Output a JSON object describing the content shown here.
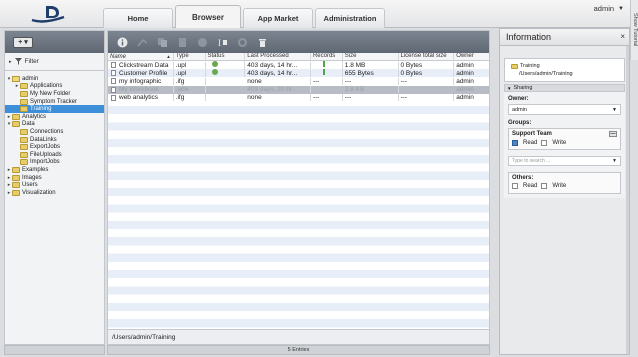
{
  "topbar": {
    "tabs": [
      "Home",
      "Browser",
      "App Market",
      "Administration"
    ],
    "user": "admin",
    "side_tab": "Show Tutorial"
  },
  "left": {
    "add_label": "+ ▾",
    "filter": "Filter",
    "tree": [
      {
        "label": "admin",
        "indent": 0,
        "arrow": "▾",
        "type": "home"
      },
      {
        "label": "Applications",
        "indent": 1,
        "arrow": "▸",
        "type": "folder"
      },
      {
        "label": "My New Folder",
        "indent": 1,
        "arrow": "",
        "type": "folder"
      },
      {
        "label": "Symptom Tracker",
        "indent": 1,
        "arrow": "",
        "type": "folder"
      },
      {
        "label": "Training",
        "indent": 1,
        "arrow": "",
        "type": "folder",
        "selected": true
      },
      {
        "label": "Analytics",
        "indent": 0,
        "arrow": "▸",
        "type": "folder"
      },
      {
        "label": "Data",
        "indent": 0,
        "arrow": "▾",
        "type": "folder"
      },
      {
        "label": "Connections",
        "indent": 1,
        "arrow": "",
        "type": "folder"
      },
      {
        "label": "DataLinks",
        "indent": 1,
        "arrow": "",
        "type": "folder"
      },
      {
        "label": "ExportJobs",
        "indent": 1,
        "arrow": "",
        "type": "folder"
      },
      {
        "label": "FileUploads",
        "indent": 1,
        "arrow": "",
        "type": "folder"
      },
      {
        "label": "ImportJobs",
        "indent": 1,
        "arrow": "",
        "type": "folder"
      },
      {
        "label": "Examples",
        "indent": 0,
        "arrow": "▸",
        "type": "folder"
      },
      {
        "label": "Images",
        "indent": 0,
        "arrow": "▸",
        "type": "folder"
      },
      {
        "label": "Users",
        "indent": 0,
        "arrow": "▸",
        "type": "folder"
      },
      {
        "label": "Visualization",
        "indent": 0,
        "arrow": "▸",
        "type": "folder"
      }
    ]
  },
  "grid": {
    "headers": [
      "Name",
      "Type",
      "Status",
      "Last Processed",
      "Records",
      "Size",
      "License total size",
      "Owner"
    ],
    "sort_indicator": "▲",
    "rows": [
      {
        "name": "Clickstream Data",
        "type": ".upl",
        "status": "ok",
        "last": "403 days, 14 hr...",
        "records": "bar",
        "size": "1.8 MB",
        "license": "0 Bytes",
        "owner": "admin"
      },
      {
        "name": "Customer Profile",
        "type": ".upl",
        "status": "ok",
        "last": "403 days, 14 hr...",
        "records": "bar",
        "size": "655 Bytes",
        "license": "0 Bytes",
        "owner": "admin"
      },
      {
        "name": "my infographic",
        "type": ".ifg",
        "status": "",
        "last": "none",
        "records": "---",
        "size": "---",
        "license": "---",
        "owner": "admin"
      },
      {
        "name": "My Workbook",
        "type": ".wbk",
        "status": "",
        "last": "403 days, 20 hr...",
        "records": "",
        "size": "2.8 KB",
        "license": "",
        "owner": "admin",
        "selected": true
      },
      {
        "name": "web analytics",
        "type": ".ifg",
        "status": "",
        "last": "none",
        "records": "---",
        "size": "---",
        "license": "---",
        "owner": "admin"
      }
    ],
    "path": "/Users/admin/Training",
    "entries": "5 Entries"
  },
  "info": {
    "title": "Information",
    "close": "×",
    "folder_name": "Training",
    "folder_path": "/Users/admin/Training",
    "sharing": "Sharing",
    "owner_label": "Owner:",
    "owner_value": "admin",
    "groups_label": "Groups:",
    "group_name": "Support Team",
    "group_btn": "—",
    "read": "Read",
    "write": "Write",
    "search_placeholder": "Type to search ...",
    "others_label": "Others:",
    "others_read": "Read",
    "others_write": "Write"
  },
  "colors": {
    "accent": "#3d8fd9",
    "toolbar": "#6b7480",
    "ok": "#6aa84f"
  }
}
